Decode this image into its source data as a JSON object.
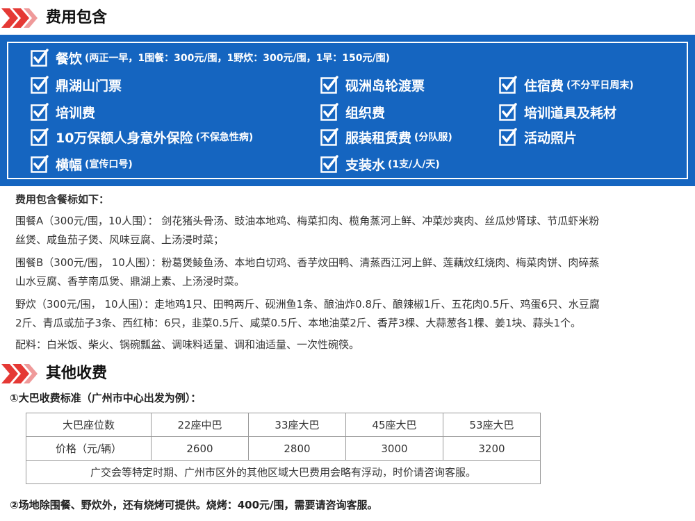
{
  "section1": {
    "title": "费用包含"
  },
  "inclusions": {
    "meals": {
      "label": "餐饮",
      "note": "(两正一早，1围餐：300元/围，1野炊：300元/围，1早：150元/围)"
    },
    "col1": [
      {
        "label": "鼎湖山门票",
        "note": ""
      },
      {
        "label": "培训费",
        "note": ""
      },
      {
        "label": "10万保额人身意外保险",
        "note": "(不保急性病)"
      },
      {
        "label": "横幅",
        "note": "(宣传口号)"
      }
    ],
    "col2": [
      {
        "label": "砚洲岛轮渡票",
        "note": ""
      },
      {
        "label": "组织费",
        "note": ""
      },
      {
        "label": "服装租赁费",
        "note": "(分队服)"
      },
      {
        "label": "支装水",
        "note": "(1支/人/天)"
      }
    ],
    "col3": [
      {
        "label": "住宿费",
        "note": "(不分平日周末)"
      },
      {
        "label": "培训道具及耗材",
        "note": ""
      },
      {
        "label": "活动照片",
        "note": ""
      }
    ]
  },
  "menu": {
    "heading": "费用包含餐标如下：",
    "line1": "围餐A（300元/围，10人围）： 剑花猪头骨汤、豉油本地鸡、梅菜扣肉、榄角蒸河上鲜、冲菜炒爽肉、丝瓜炒肾球、节瓜虾米粉",
    "line2": "丝煲、咸鱼茄子煲、风味豆腐、上汤浸时菜；",
    "line3": "围餐B（300元/围， 10人围）：粉葛煲鲮鱼汤、本地白切鸡、香芋炆田鸭、清蒸西江河上鲜、莲藕炆红烧肉、梅菜肉饼、肉碎蒸",
    "line4": "山水豆腐、香芋南瓜煲、鼎湖上素、上汤浸时菜。",
    "line5": "野炊（300元/围， 10人围）：走地鸡1只、田鸭两斤、砚洲鱼1条、酿油炸0.8斤、酿辣椒1斤、五花肉0.5斤、鸡蛋6只、水豆腐",
    "line6": "2斤、青瓜或茄子3条、西红柿：6只，韭菜0.5斤、咸菜0.5斤、本地油菜2斤、香芹3棵、大蒜葱各1棵、姜1块、蒜头1个。",
    "line7": "配料：白米饭、柴火、锅碗瓢盆、调味料适量、调和油适量、一次性碗筷。"
  },
  "section2": {
    "title": "其他收费"
  },
  "bus": {
    "heading": "①大巴收费标准（广州市中心出发为例）：",
    "header_row": [
      "大巴座位数",
      "22座中巴",
      "33座大巴",
      "45座大巴",
      "53座大巴"
    ],
    "price_row": [
      "价格（元/辆）",
      "2600",
      "2800",
      "3000",
      "3200"
    ],
    "note": "广交会等特定时期、广州市区外的其他区域大巴费用会略有浮动，时价请咨询客服。"
  },
  "footnote": "②场地除围餐、野炊外，还有烧烤可提供。烧烤：400元/围，需要请咨询客服。",
  "colors": {
    "accent": "#e53935",
    "box": "#1565c0"
  },
  "icons": {
    "bullet": "double-chevron-icon",
    "check": "checkbox-checked-icon"
  }
}
